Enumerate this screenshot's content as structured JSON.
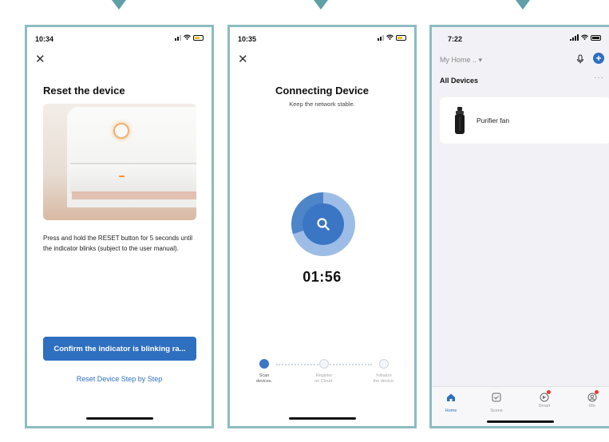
{
  "colors": {
    "accent": "#2f6fc0",
    "frame": "#8cbcc2",
    "arrow": "#5f9fa8",
    "indicator": "#ff8a30"
  },
  "screen1": {
    "time": "10:34",
    "title": "Reset the device",
    "image_alt": "device with power button and indicator",
    "description": "Press and hold the RESET button for 5 seconds until the indicator blinks (subject to the user manual).",
    "confirm_button": "Confirm the indicator is blinking ra...",
    "link": "Reset Device Step by Step"
  },
  "screen2": {
    "time": "10:35",
    "title": "Connecting Device",
    "subtitle": "Keep the network stable.",
    "timer": "01:56",
    "steps": [
      {
        "line1": "Scan",
        "line2": "devices."
      },
      {
        "line1": "Register",
        "line2": "on Cloud."
      },
      {
        "line1": "Initialize",
        "line2": "the device."
      }
    ]
  },
  "screen3": {
    "time": "7:22",
    "home_select": "My Home .. ▾",
    "section": "All Devices",
    "more": "···",
    "device_name": "Purifier fan",
    "tabs": [
      {
        "label": "Home",
        "icon": "home-icon"
      },
      {
        "label": "Scene",
        "icon": "scene-icon"
      },
      {
        "label": "Smart",
        "icon": "smart-icon"
      },
      {
        "label": "Me",
        "icon": "me-icon"
      }
    ]
  }
}
